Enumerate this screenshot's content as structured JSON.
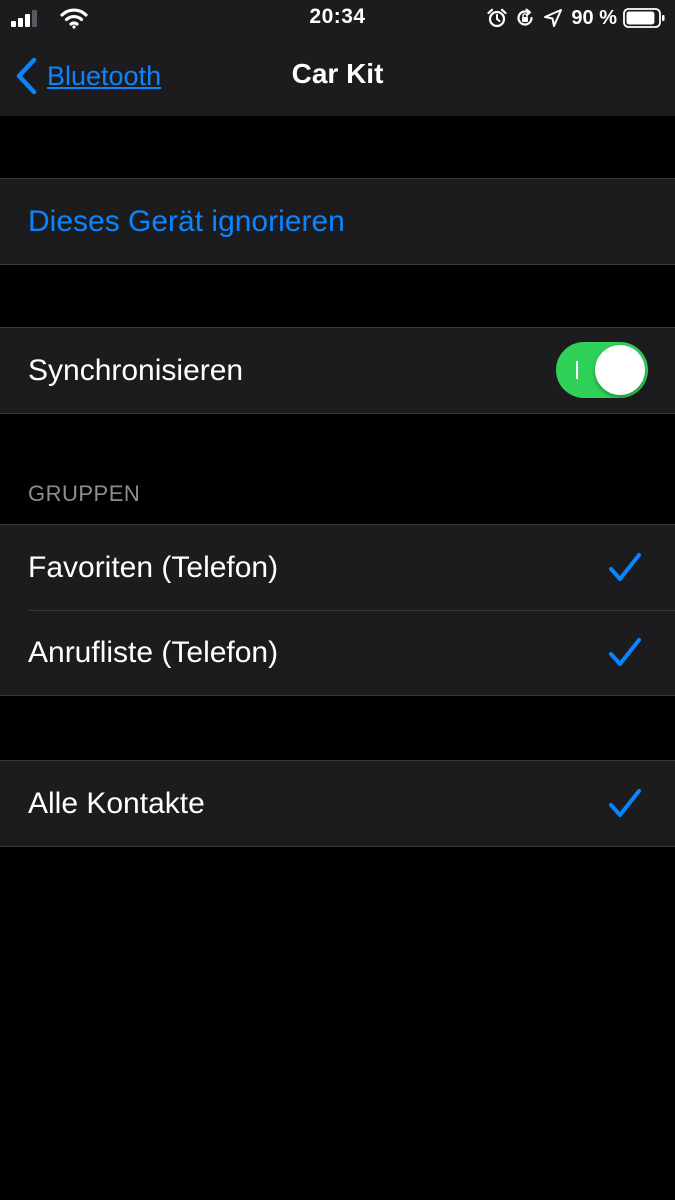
{
  "status_bar": {
    "time": "20:34",
    "battery_percent": "90 %",
    "battery_level": 0.9,
    "icons": [
      "signal-icon",
      "wifi-icon",
      "alarm-icon",
      "orientation-lock-icon",
      "location-arrow-icon",
      "battery-icon"
    ]
  },
  "nav": {
    "back_label": "Bluetooth",
    "title": "Car Kit"
  },
  "device": {
    "forget_label": "Dieses Gerät ignorieren"
  },
  "sync": {
    "label": "Synchronisieren",
    "enabled": true
  },
  "groups": {
    "header": "GRUPPEN",
    "items": [
      {
        "label": "Favoriten (Telefon)",
        "checked": true
      },
      {
        "label": "Anrufliste (Telefon)",
        "checked": true
      }
    ]
  },
  "contacts": {
    "label": "Alle Kontakte",
    "checked": true
  },
  "colors": {
    "accent": "#0a84ff",
    "toggle_on": "#30d158",
    "background": "#000000",
    "cell_background": "#1c1c1e",
    "secondary_text": "#8d8d93"
  }
}
